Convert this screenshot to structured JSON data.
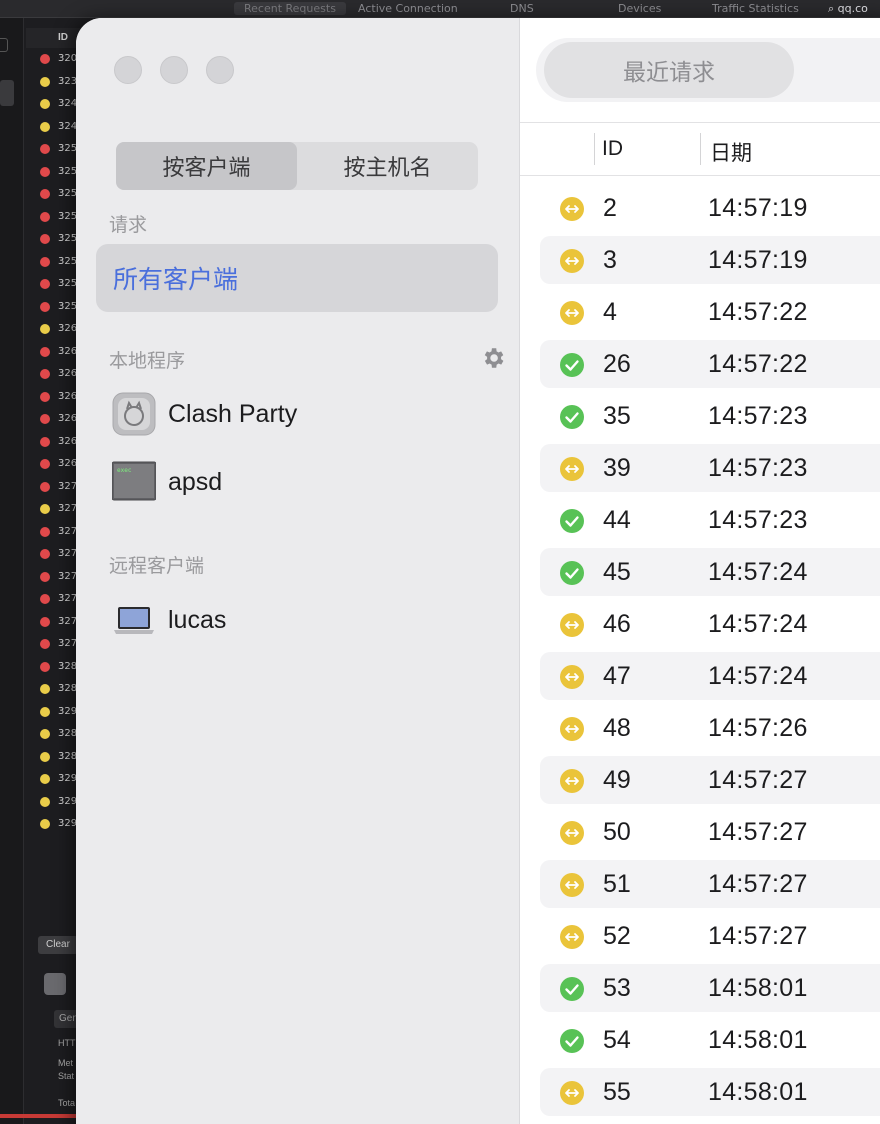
{
  "background_app": {
    "tabs": [
      "Recent Requests",
      "Active Connection",
      "DNS",
      "Devices",
      "Traffic Statistics"
    ],
    "search_text": "qq.co",
    "list_header": "ID",
    "ids": [
      "320",
      "323",
      "324",
      "324",
      "325",
      "325",
      "325",
      "325",
      "325",
      "325",
      "325",
      "325",
      "326",
      "326",
      "326",
      "326",
      "326",
      "326",
      "326",
      "327",
      "327",
      "327",
      "327",
      "327",
      "327",
      "327",
      "327",
      "328",
      "328",
      "329",
      "328",
      "328",
      "329",
      "329",
      "329"
    ],
    "statuses": [
      "red",
      "yellow",
      "yellow",
      "yellow",
      "red",
      "red",
      "red",
      "red",
      "red",
      "red",
      "red",
      "red",
      "yellow",
      "red",
      "red",
      "red",
      "red",
      "red",
      "red",
      "red",
      "yellow",
      "red",
      "red",
      "red",
      "red",
      "red",
      "red",
      "red",
      "yellow",
      "yellow",
      "yellow",
      "yellow",
      "yellow",
      "yellow",
      "yellow"
    ],
    "clear_button": "Clear",
    "general_label": "Gen",
    "http_label": "HTT",
    "method_label": "Met",
    "status_label": "Stat",
    "total_label": "Tota"
  },
  "sidebar": {
    "segments": [
      "按客户端",
      "按主机名"
    ],
    "requests_section": "请求",
    "all_clients": "所有客户端",
    "local_section": "本地程序",
    "local_apps": [
      {
        "name": "Clash Party",
        "icon": "clash-party-icon"
      },
      {
        "name": "apsd",
        "icon": "terminal-icon"
      }
    ],
    "remote_section": "远程客户端",
    "remote_clients": [
      {
        "name": "lucas",
        "icon": "laptop-icon"
      }
    ]
  },
  "main": {
    "toolbar_button": "最近请求",
    "columns": [
      "ID",
      "日期"
    ],
    "rows": [
      {
        "id": "2",
        "date": "14:57:19",
        "status": "pending"
      },
      {
        "id": "3",
        "date": "14:57:19",
        "status": "pending"
      },
      {
        "id": "4",
        "date": "14:57:22",
        "status": "pending"
      },
      {
        "id": "26",
        "date": "14:57:22",
        "status": "success"
      },
      {
        "id": "35",
        "date": "14:57:23",
        "status": "success"
      },
      {
        "id": "39",
        "date": "14:57:23",
        "status": "pending"
      },
      {
        "id": "44",
        "date": "14:57:23",
        "status": "success"
      },
      {
        "id": "45",
        "date": "14:57:24",
        "status": "success"
      },
      {
        "id": "46",
        "date": "14:57:24",
        "status": "pending"
      },
      {
        "id": "47",
        "date": "14:57:24",
        "status": "pending"
      },
      {
        "id": "48",
        "date": "14:57:26",
        "status": "pending"
      },
      {
        "id": "49",
        "date": "14:57:27",
        "status": "pending"
      },
      {
        "id": "50",
        "date": "14:57:27",
        "status": "pending"
      },
      {
        "id": "51",
        "date": "14:57:27",
        "status": "pending"
      },
      {
        "id": "52",
        "date": "14:57:27",
        "status": "pending"
      },
      {
        "id": "53",
        "date": "14:58:01",
        "status": "success"
      },
      {
        "id": "54",
        "date": "14:58:01",
        "status": "success"
      },
      {
        "id": "55",
        "date": "14:58:01",
        "status": "pending"
      }
    ]
  },
  "colors": {
    "accent": "#4a6fdc",
    "pending": "#eac43a",
    "success": "#58c256",
    "error": "#e0494b"
  }
}
